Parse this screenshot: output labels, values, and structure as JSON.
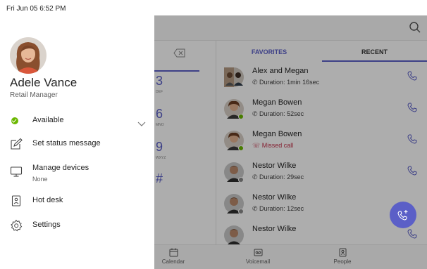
{
  "status_bar": {
    "datetime": "Fri Jun 05  6:52 PM"
  },
  "user": {
    "name": "Adele Vance",
    "title": "Retail Manager"
  },
  "menu": {
    "status_label": "Available",
    "status_color": "#6bb700",
    "set_status_message": "Set status message",
    "manage_devices": "Manage devices",
    "manage_devices_sub": "None",
    "hot_desk": "Hot desk",
    "settings": "Settings"
  },
  "dialpad": {
    "keys": [
      {
        "digit": "3",
        "letters": "DEF"
      },
      {
        "digit": "6",
        "letters": "MNO"
      },
      {
        "digit": "9",
        "letters": "WXYZ"
      },
      {
        "digit": "#",
        "letters": ""
      }
    ]
  },
  "tabs": {
    "favorites": "FAVORITES",
    "recent": "RECENT"
  },
  "calls": [
    {
      "name": "Alex and Megan",
      "detail": "Duration: 1min 16sec",
      "missed": false,
      "presence": ""
    },
    {
      "name": "Megan Bowen",
      "detail": "Duration: 52sec",
      "missed": false,
      "presence": "#6bb700"
    },
    {
      "name": "Megan Bowen",
      "detail": "Missed call",
      "missed": true,
      "presence": "#6bb700"
    },
    {
      "name": "Nestor Wilke",
      "detail": "Duration: 29sec",
      "missed": false,
      "presence": "#8a8a8a"
    },
    {
      "name": "Nestor Wilke",
      "detail": "Duration: 12sec",
      "missed": false,
      "presence": "#8a8a8a"
    },
    {
      "name": "Nestor Wilke",
      "detail": "",
      "missed": false,
      "presence": ""
    }
  ],
  "bottom_nav": {
    "calendar": "Calendar",
    "voicemail": "Voicemail",
    "people": "People"
  },
  "colors": {
    "accent": "#5b5fc7",
    "available": "#6bb700",
    "missed": "#c4314b"
  },
  "icons": {
    "search": "search-icon",
    "backspace": "backspace-icon",
    "phone": "phone-icon",
    "new_call": "dial-icon",
    "edit": "edit-icon",
    "monitor": "monitor-icon",
    "hot_desk": "hot-desk-icon",
    "settings": "gear-icon",
    "chevron": "chevron-down-icon"
  }
}
